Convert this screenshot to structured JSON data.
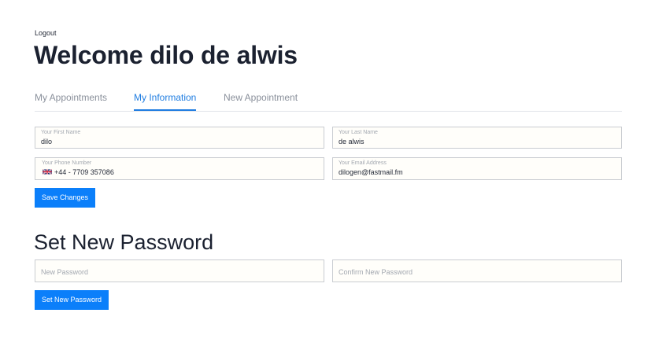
{
  "header": {
    "logout_label": "Logout",
    "title": "Welcome dilo de alwis"
  },
  "tabs": [
    {
      "label": "My Appointments",
      "active": false
    },
    {
      "label": "My Information",
      "active": true
    },
    {
      "label": "New Appointment",
      "active": false
    }
  ],
  "profile_form": {
    "first_name": {
      "label": "Your First Name",
      "value": "dilo"
    },
    "last_name": {
      "label": "Your Last Name",
      "value": "de alwis"
    },
    "phone": {
      "label": "Your Phone Number",
      "value": "+44 - 7709 357086",
      "flag": "uk-flag-icon"
    },
    "email": {
      "label": "Your Email Address",
      "value": "dilogen@fastmail.fm"
    },
    "save_label": "Save Changes"
  },
  "password_section": {
    "title": "Set New Password",
    "new_password_placeholder": "New Password",
    "confirm_password_placeholder": "Confirm New Password",
    "submit_label": "Set New Password"
  },
  "colors": {
    "accent": "#0b7ffa",
    "tab_active": "#1f7de1",
    "text": "#1b2130"
  }
}
